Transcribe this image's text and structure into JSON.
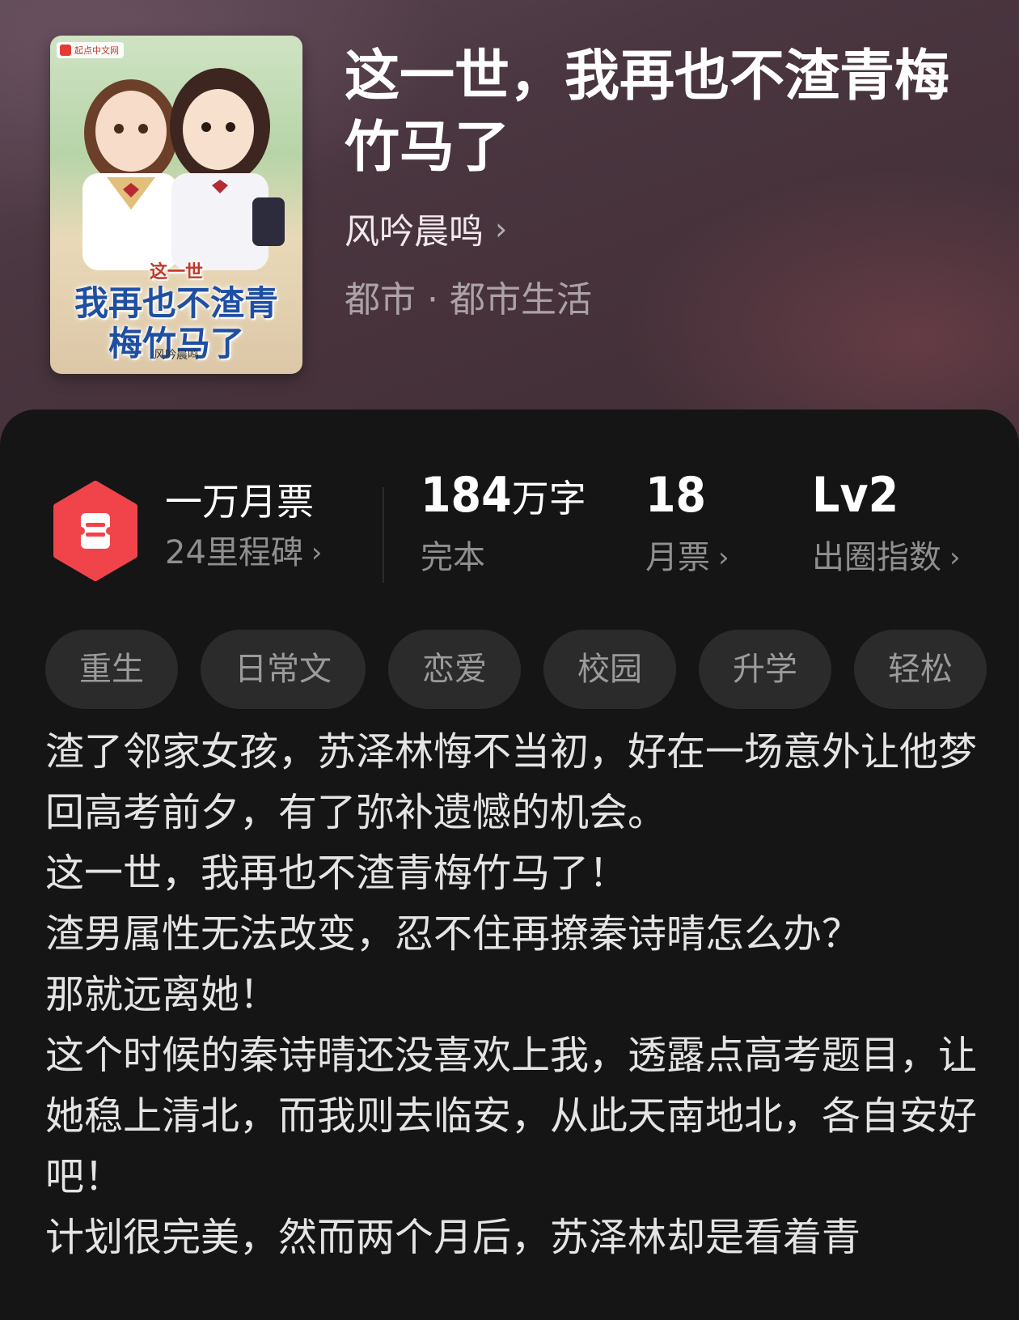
{
  "book": {
    "title": "这一世，我再也不渣青梅竹马了",
    "author": "风吟晨鸣",
    "genre": "都市 · 都市生活",
    "cover": {
      "publisher": "起点中文网",
      "title_small": "这一世",
      "title_main": "我再也不渣青梅竹马了",
      "author": "风吟晨鸣"
    }
  },
  "stats": {
    "milestone_title": "一万月票",
    "milestone_sub": "24里程碑",
    "word_count_number": "184",
    "word_count_unit": "万字",
    "status": "完本",
    "monthly_tickets_value": "18",
    "monthly_tickets_label": "月票",
    "index_value": "Lv2",
    "index_label": "出圈指数"
  },
  "tags": [
    "重生",
    "日常文",
    "恋爱",
    "校园",
    "升学",
    "轻松"
  ],
  "synopsis": [
    "渣了邻家女孩，苏泽林悔不当初，好在一场意外让他梦回高考前夕，有了弥补遗憾的机会。",
    "这一世，我再也不渣青梅竹马了！",
    "渣男属性无法改变，忍不住再撩秦诗晴怎么办？",
    "那就远离她！",
    "这个时候的秦诗晴还没喜欢上我，透露点高考题目，让她稳上清北，而我则去临安，从此天南地北，各自安好吧！",
    "计划很完美，然而两个月后，苏泽林却是看着青"
  ],
  "colors": {
    "accent": "#f0444a",
    "panel": "#151515",
    "tag_bg": "#2b2b2b",
    "muted": "#8f8f8f"
  }
}
